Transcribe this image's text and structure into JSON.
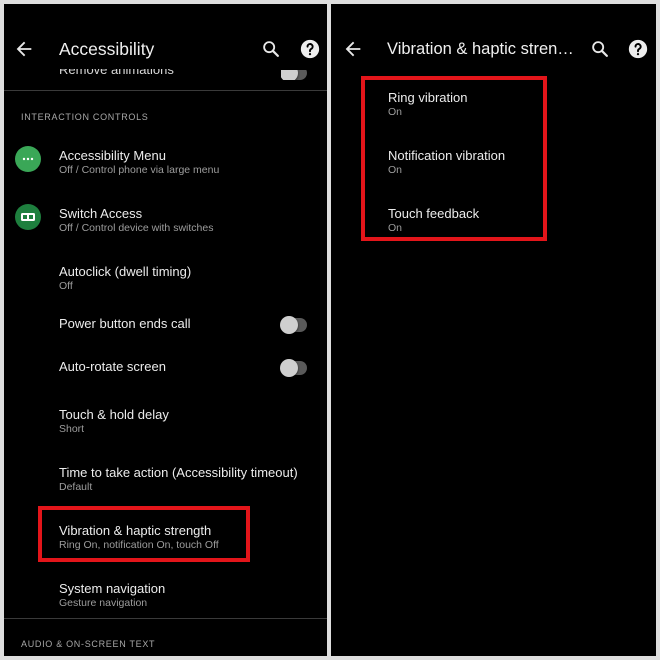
{
  "left_panel": {
    "toolbar": {
      "title": "Accessibility",
      "back_icon": "arrow-left-icon",
      "search_icon": "search-icon",
      "help_icon": "help-icon"
    },
    "clipped_item_label": "Remove animations",
    "section_interaction": "INTERACTION CONTROLS",
    "items": [
      {
        "title": "Accessibility Menu",
        "subtitle": "Off / Control phone via large menu",
        "icon": "accessibility-menu-icon"
      },
      {
        "title": "Switch Access",
        "subtitle": "Off / Control device with switches",
        "icon": "switch-access-icon"
      },
      {
        "title": "Autoclick (dwell timing)",
        "subtitle": "Off"
      },
      {
        "title": "Power button ends call"
      },
      {
        "title": "Auto-rotate screen"
      },
      {
        "title": "Touch & hold delay",
        "subtitle": "Short"
      },
      {
        "title": "Time to take action (Accessibility timeout)",
        "subtitle": "Default"
      },
      {
        "title": "Vibration & haptic strength",
        "subtitle": "Ring On, notification On, touch Off"
      },
      {
        "title": "System navigation",
        "subtitle": "Gesture navigation"
      }
    ],
    "section_audio": "AUDIO & ON-SCREEN TEXT"
  },
  "right_panel": {
    "toolbar": {
      "title": "Vibration & haptic strength",
      "back_icon": "arrow-left-icon",
      "search_icon": "search-icon",
      "help_icon": "help-icon"
    },
    "items": [
      {
        "title": "Ring vibration",
        "subtitle": "On"
      },
      {
        "title": "Notification vibration",
        "subtitle": "On"
      },
      {
        "title": "Touch feedback",
        "subtitle": "On"
      }
    ]
  },
  "colors": {
    "background": "#000000",
    "highlight": "#e3151a",
    "accent_green": "#3aa757"
  }
}
